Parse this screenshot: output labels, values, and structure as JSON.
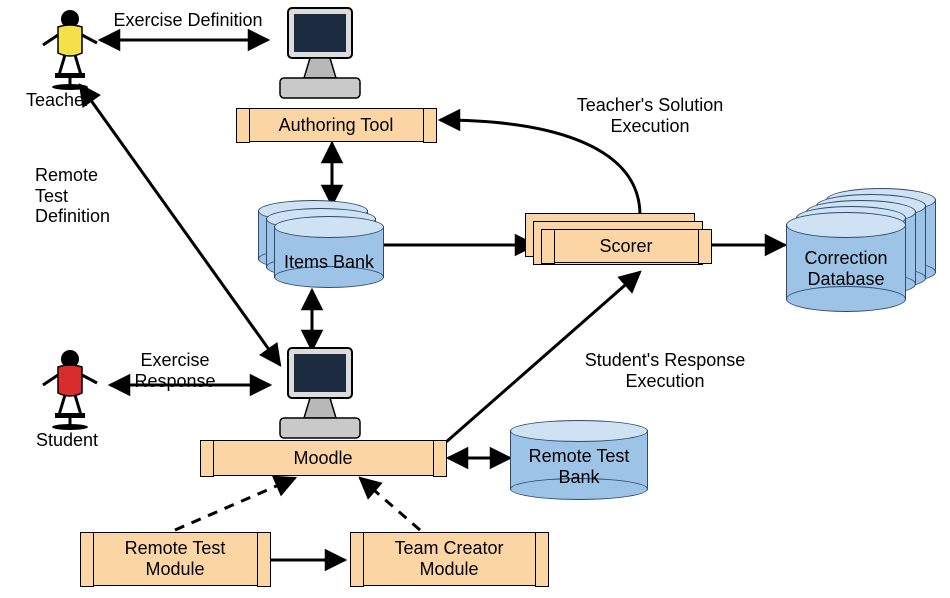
{
  "actors": {
    "teacher": "Teacher",
    "student": "Student"
  },
  "nodes": {
    "authoring_tool": "Authoring Tool",
    "items_bank": "Items Bank",
    "scorer": "Scorer",
    "correction_db_line1": "Correction",
    "correction_db_line2": "Database",
    "moodle": "Moodle",
    "remote_test_bank_line1": "Remote Test",
    "remote_test_bank_line2": "Bank",
    "remote_test_module_line1": "Remote Test",
    "remote_test_module_line2": "Module",
    "team_creator_module_line1": "Team Creator",
    "team_creator_module_line2": "Module"
  },
  "edges": {
    "exercise_definition": "Exercise Definition",
    "remote_test_definition_l1": "Remote",
    "remote_test_definition_l2": "Test",
    "remote_test_definition_l3": "Definition",
    "exercise_response_l1": "Exercise",
    "exercise_response_l2": "Response",
    "teacher_solution_l1": "Teacher's Solution",
    "teacher_solution_l2": "Execution",
    "student_response_l1": "Student's Response",
    "student_response_l2": "Execution"
  },
  "chart_data": {
    "type": "diagram",
    "entities": [
      {
        "id": "teacher",
        "kind": "actor",
        "label": "Teacher"
      },
      {
        "id": "student",
        "kind": "actor",
        "label": "Student"
      },
      {
        "id": "authoring_tool",
        "kind": "component",
        "label": "Authoring Tool"
      },
      {
        "id": "items_bank",
        "kind": "datastore",
        "label": "Items Bank"
      },
      {
        "id": "scorer",
        "kind": "component",
        "label": "Scorer"
      },
      {
        "id": "correction_database",
        "kind": "datastore",
        "label": "Correction Database"
      },
      {
        "id": "moodle",
        "kind": "component",
        "label": "Moodle"
      },
      {
        "id": "remote_test_bank",
        "kind": "datastore",
        "label": "Remote Test Bank"
      },
      {
        "id": "remote_test_module",
        "kind": "module",
        "label": "Remote Test Module"
      },
      {
        "id": "team_creator_module",
        "kind": "module",
        "label": "Team Creator Module"
      }
    ],
    "relations": [
      {
        "from": "teacher",
        "to": "authoring_tool",
        "label": "Exercise Definition",
        "dir": "both"
      },
      {
        "from": "teacher",
        "to": "moodle",
        "label": "Remote Test Definition",
        "dir": "both"
      },
      {
        "from": "student",
        "to": "moodle",
        "label": "Exercise Response",
        "dir": "both"
      },
      {
        "from": "authoring_tool",
        "to": "items_bank",
        "dir": "both"
      },
      {
        "from": "items_bank",
        "to": "moodle",
        "dir": "both"
      },
      {
        "from": "items_bank",
        "to": "scorer",
        "dir": "forward"
      },
      {
        "from": "scorer",
        "to": "authoring_tool",
        "label": "Teacher's Solution Execution",
        "dir": "forward"
      },
      {
        "from": "moodle",
        "to": "scorer",
        "label": "Student's Response Execution",
        "dir": "forward"
      },
      {
        "from": "scorer",
        "to": "correction_database",
        "dir": "forward"
      },
      {
        "from": "moodle",
        "to": "remote_test_bank",
        "dir": "both"
      },
      {
        "from": "remote_test_module",
        "to": "moodle",
        "style": "dashed",
        "dir": "forward"
      },
      {
        "from": "team_creator_module",
        "to": "moodle",
        "style": "dashed",
        "dir": "forward"
      },
      {
        "from": "remote_test_module",
        "to": "team_creator_module",
        "dir": "forward"
      }
    ]
  }
}
